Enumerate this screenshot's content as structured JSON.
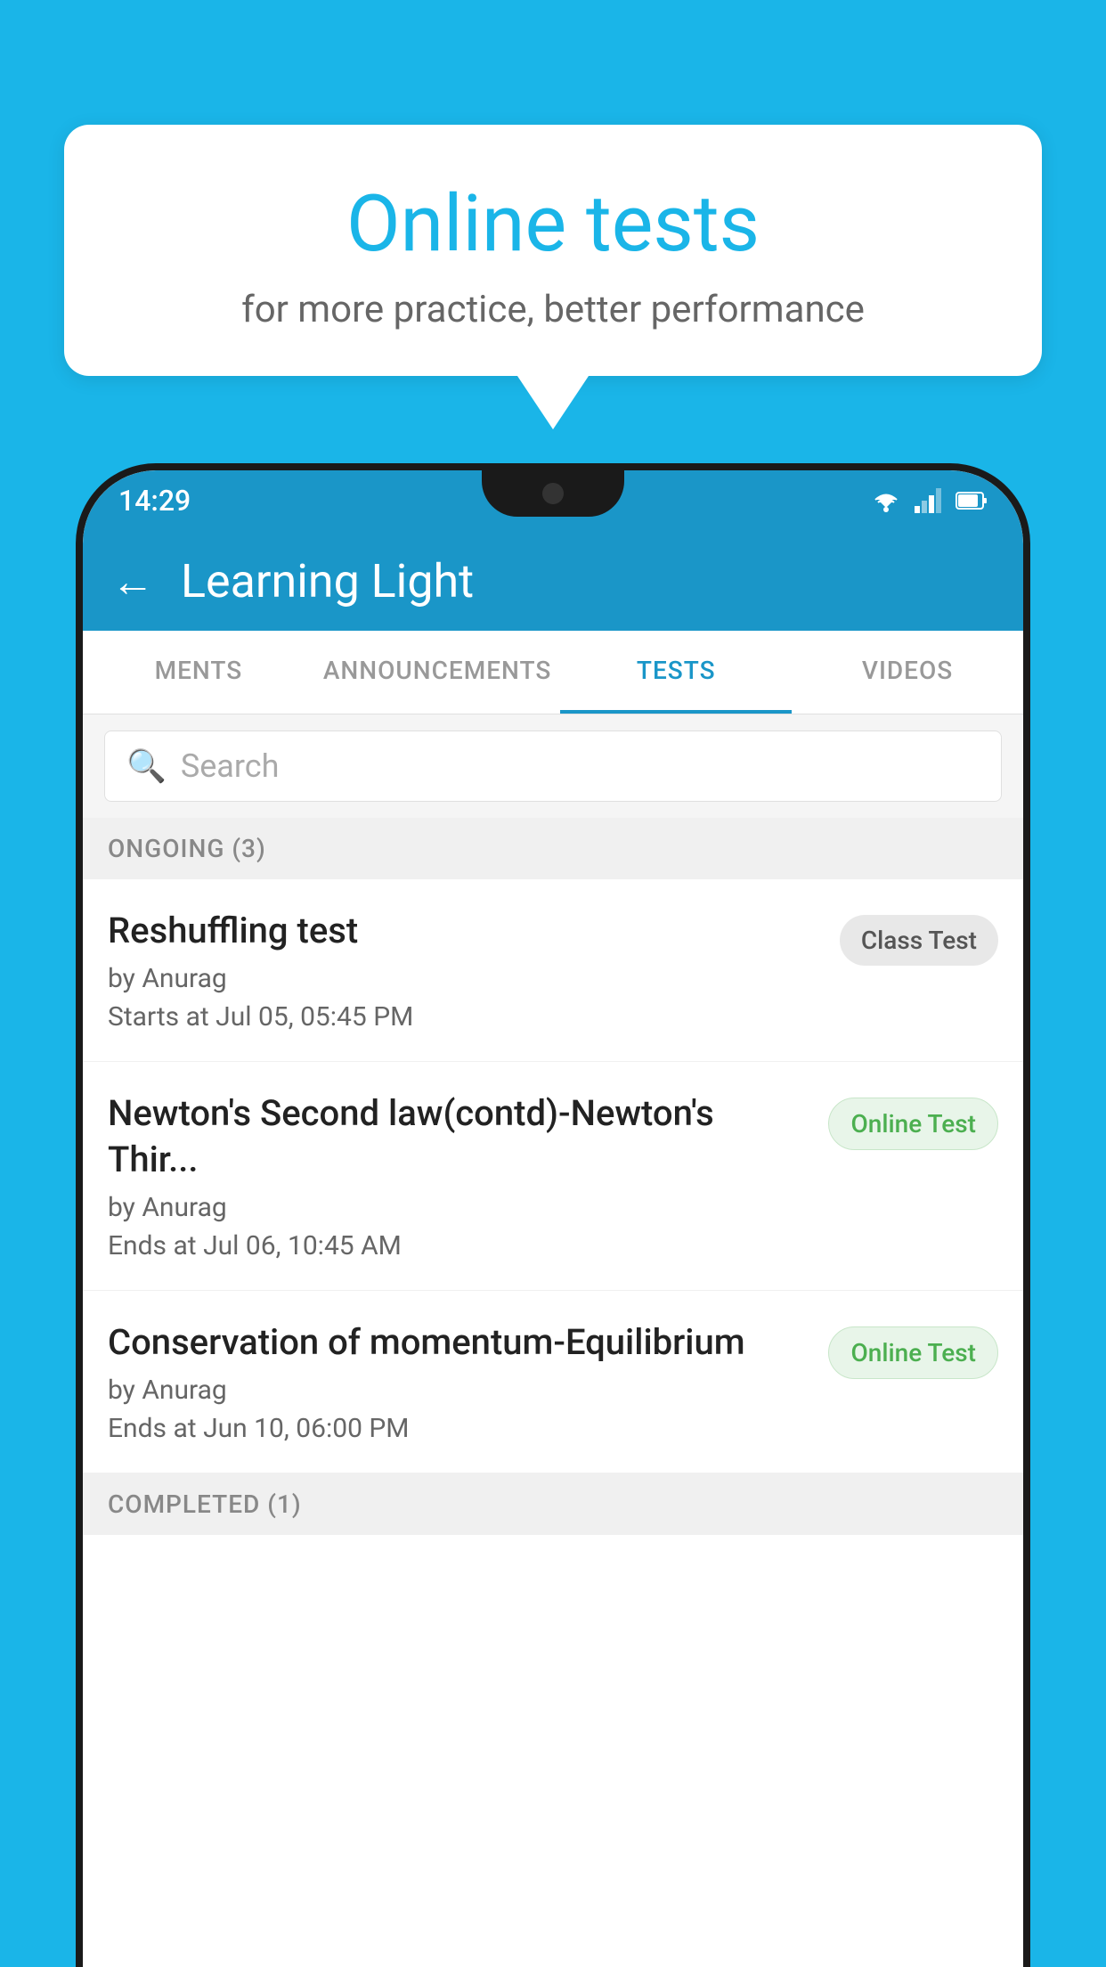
{
  "background_color": "#1ab5e8",
  "speech_bubble": {
    "title": "Online tests",
    "subtitle": "for more practice, better performance"
  },
  "status_bar": {
    "time": "14:29"
  },
  "app_bar": {
    "back_icon": "←",
    "title": "Learning Light"
  },
  "tabs": [
    {
      "label": "MENTS",
      "active": false
    },
    {
      "label": "ANNOUNCEMENTS",
      "active": false
    },
    {
      "label": "TESTS",
      "active": true
    },
    {
      "label": "VIDEOS",
      "active": false
    }
  ],
  "search": {
    "placeholder": "Search"
  },
  "sections": [
    {
      "title": "ONGOING (3)",
      "tests": [
        {
          "name": "Reshuffling test",
          "author": "by Anurag",
          "time_label": "Starts at",
          "time": "Jul 05, 05:45 PM",
          "badge": "Class Test",
          "badge_type": "class"
        },
        {
          "name": "Newton's Second law(contd)-Newton's Thir...",
          "author": "by Anurag",
          "time_label": "Ends at",
          "time": "Jul 06, 10:45 AM",
          "badge": "Online Test",
          "badge_type": "online"
        },
        {
          "name": "Conservation of momentum-Equilibrium",
          "author": "by Anurag",
          "time_label": "Ends at",
          "time": "Jun 10, 06:00 PM",
          "badge": "Online Test",
          "badge_type": "online"
        }
      ]
    }
  ],
  "completed_section": {
    "title": "COMPLETED (1)"
  }
}
